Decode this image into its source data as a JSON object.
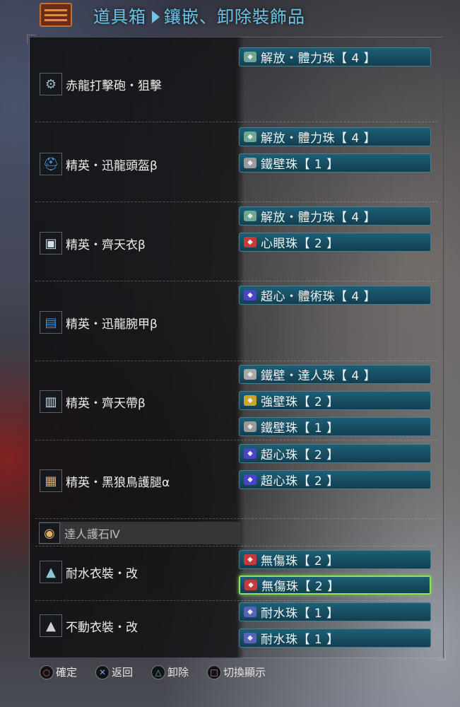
{
  "header": {
    "title_main": "道具箱",
    "title_sub": "鑲嵌、卸除裝飾品"
  },
  "equipment": [
    {
      "name": "赤龍打擊砲・狙擊",
      "icon": "weapon-icon",
      "slots": [
        {
          "label": "解放・體力珠【 4 】",
          "gem_color": "#6fa894"
        }
      ]
    },
    {
      "name": "精英・迅龍頭盔β",
      "icon": "helmet-icon",
      "slots": [
        {
          "label": "解放・體力珠【 4 】",
          "gem_color": "#6fa894"
        },
        {
          "label": "鐵壁珠【 1 】",
          "gem_color": "#9a9a9a"
        }
      ]
    },
    {
      "name": "精英・齊天衣β",
      "icon": "chest-armor-icon",
      "slots": [
        {
          "label": "解放・體力珠【 4 】",
          "gem_color": "#6fa894"
        },
        {
          "label": "心眼珠【 2 】",
          "gem_color": "#c63a3a"
        }
      ]
    },
    {
      "name": "精英・迅龍腕甲β",
      "icon": "arm-armor-icon",
      "slots": [
        {
          "label": "超心・體術珠【 4 】",
          "gem_color": "#4a45c4"
        }
      ]
    },
    {
      "name": "精英・齊天帶β",
      "icon": "waist-armor-icon",
      "slots": [
        {
          "label": "鐵壁・達人珠【 4 】",
          "gem_color": "#a8a8a8"
        },
        {
          "label": "強壁珠【 2 】",
          "gem_color": "#c9a629"
        },
        {
          "label": "鐵壁珠【 1 】",
          "gem_color": "#9a9a9a"
        }
      ]
    },
    {
      "name": "精英・黑狼鳥護腿α",
      "icon": "leg-armor-icon",
      "slots": [
        {
          "label": "超心珠【 2 】",
          "gem_color": "#4a45c4"
        },
        {
          "label": "超心珠【 2 】",
          "gem_color": "#4a45c4"
        }
      ]
    }
  ],
  "charm": {
    "name": "達人護石Ⅳ",
    "icon": "charm-icon"
  },
  "layered": [
    {
      "name": "耐水衣裝・改",
      "icon": "layered-armor-icon",
      "slots": [
        {
          "label": "無傷珠【 2 】",
          "gem_color": "#c63a3a",
          "selected": false
        },
        {
          "label": "無傷珠【 2 】",
          "gem_color": "#c63a3a",
          "selected": true
        }
      ]
    },
    {
      "name": "不動衣裝・改",
      "icon": "layered-armor-icon",
      "slots": [
        {
          "label": "耐水珠【 1 】",
          "gem_color": "#5a62b8"
        },
        {
          "label": "耐水珠【 1 】",
          "gem_color": "#5a62b8"
        }
      ]
    }
  ],
  "footer": {
    "confirm": "確定",
    "back": "返回",
    "remove": "卸除",
    "toggle": "切換顯示",
    "confirm_icon": "circle-button-icon",
    "back_icon": "cross-button-icon",
    "remove_icon": "triangle-button-icon",
    "toggle_icon": "square-button-icon",
    "confirm_color": "#d64a6b",
    "back_color": "#7aa0e8",
    "remove_color": "#3ec4a8",
    "toggle_color": "#d67ab0"
  }
}
